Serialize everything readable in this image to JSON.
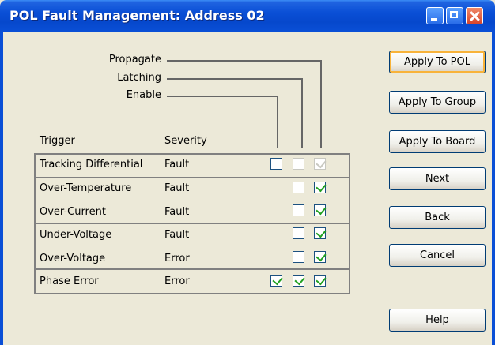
{
  "window": {
    "title": "POL Fault Management: Address 02"
  },
  "header_labels": {
    "propagate": "Propagate",
    "latching": "Latching",
    "enable": "Enable"
  },
  "columns": {
    "trigger": "Trigger",
    "severity": "Severity"
  },
  "rows": [
    {
      "trigger": "Tracking Differential",
      "severity": "Fault",
      "enable": false,
      "latching": false,
      "propagate": true,
      "enable_enabled": true,
      "latching_enabled": false,
      "propagate_enabled": false
    },
    {
      "trigger": "Over-Temperature",
      "severity": "Fault",
      "enable": null,
      "latching": false,
      "propagate": true
    },
    {
      "trigger": "Over-Current",
      "severity": "Fault",
      "enable": null,
      "latching": false,
      "propagate": true
    },
    {
      "trigger": "Under-Voltage",
      "severity": "Fault",
      "enable": null,
      "latching": false,
      "propagate": true
    },
    {
      "trigger": "Over-Voltage",
      "severity": "Error",
      "enable": null,
      "latching": false,
      "propagate": true
    },
    {
      "trigger": "Phase Error",
      "severity": "Error",
      "enable": true,
      "latching": true,
      "propagate": true
    }
  ],
  "buttons": {
    "apply_pol": "Apply To POL",
    "apply_group": "Apply To Group",
    "apply_board": "Apply To Board",
    "next": "Next",
    "back": "Back",
    "cancel": "Cancel",
    "help": "Help"
  }
}
